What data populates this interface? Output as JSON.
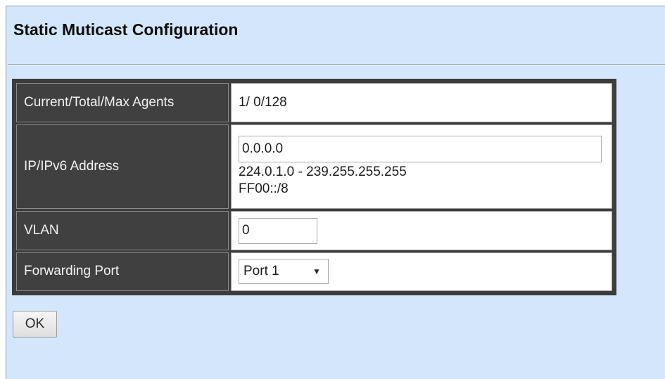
{
  "page": {
    "title": "Static Muticast Configuration"
  },
  "form": {
    "agents": {
      "label": "Current/Total/Max Agents",
      "value": "1/ 0/128"
    },
    "ip": {
      "label": "IP/IPv6 Address",
      "value": "0.0.0.0",
      "range_ipv4": "224.0.1.0 - 239.255.255.255",
      "range_ipv6": "FF00::/8"
    },
    "vlan": {
      "label": "VLAN",
      "value": "0"
    },
    "forwarding_port": {
      "label": "Forwarding Port",
      "selected": "Port 1",
      "caret": "▼"
    }
  },
  "actions": {
    "ok_label": "OK"
  },
  "colors": {
    "panel_background": "#d3e6fb",
    "label_cell_background": "#404040",
    "table_border": "#3c3c3c"
  }
}
